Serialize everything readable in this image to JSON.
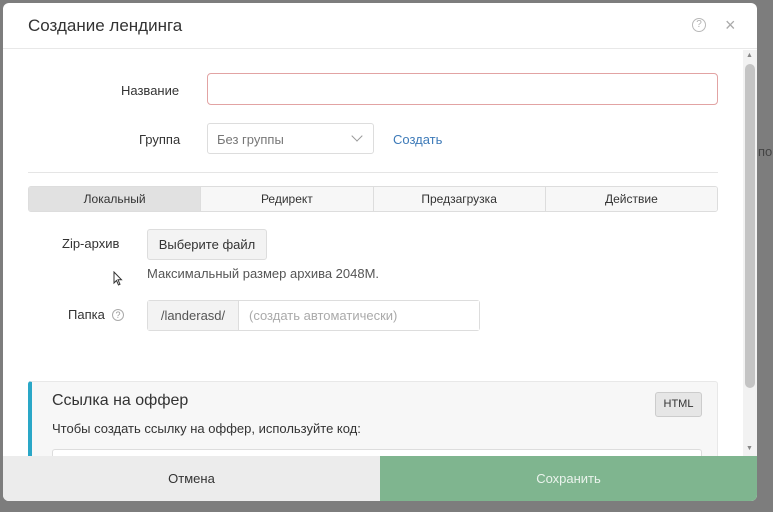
{
  "background": {
    "right_edge_text": "по"
  },
  "modal": {
    "title": "Создание лендинга",
    "help_icon": "?",
    "close_icon": "×"
  },
  "form": {
    "name": {
      "label": "Название",
      "value": ""
    },
    "group": {
      "label": "Группа",
      "selected": "Без группы",
      "create_link": "Создать"
    }
  },
  "tabs": [
    {
      "label": "Локальный",
      "active": true
    },
    {
      "label": "Редирект",
      "active": false
    },
    {
      "label": "Предзагрузка",
      "active": false
    },
    {
      "label": "Действие",
      "active": false
    }
  ],
  "zip": {
    "label": "Zip-архив",
    "button": "Выберите файл",
    "hint": "Максимальный размер архива 2048M."
  },
  "folder": {
    "label": "Папка",
    "help_icon": "?",
    "prefix": "/landerasd/",
    "placeholder": "(создать автоматически)"
  },
  "offer": {
    "title": "Ссылка на оффер",
    "hint": "Чтобы создать ссылку на оффер, используйте код:",
    "html_button": "HTML"
  },
  "footer": {
    "cancel": "Отмена",
    "save": "Сохранить"
  },
  "colors": {
    "accent": "#2aa7c7",
    "link": "#3d7ab8",
    "save": "#7fb58f",
    "error_border": "#e2a3a3"
  }
}
